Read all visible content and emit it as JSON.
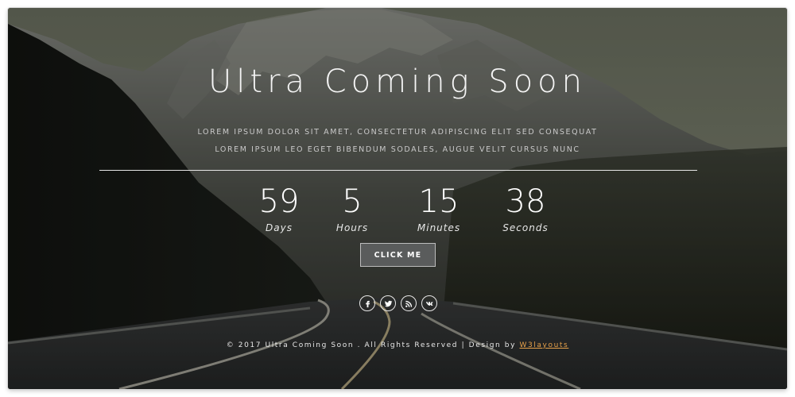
{
  "page": {
    "title": "Ultra Coming Soon",
    "description": "Lorem ipsum dolor sit amet, consectetur adipiscing elit sed consequat lorem ipsum leo eget bibendum sodales, augue velit cursus nunc"
  },
  "countdown": [
    {
      "value": "59",
      "label": "Days"
    },
    {
      "value": "5",
      "label": "Hours"
    },
    {
      "value": "15",
      "label": "Minutes"
    },
    {
      "value": "38",
      "label": "Seconds"
    }
  ],
  "button": {
    "label": "CLICK ME"
  },
  "social": [
    {
      "icon": "facebook-icon"
    },
    {
      "icon": "twitter-icon"
    },
    {
      "icon": "rss-icon"
    },
    {
      "icon": "vk-icon"
    }
  ],
  "footer": {
    "text": "© 2017 Ultra Coming Soon . All Rights Reserved | Design by ",
    "link": "W3layouts"
  },
  "colors": {
    "footer_link": "#e7a14a",
    "button_bg": "#5a5c5c"
  }
}
